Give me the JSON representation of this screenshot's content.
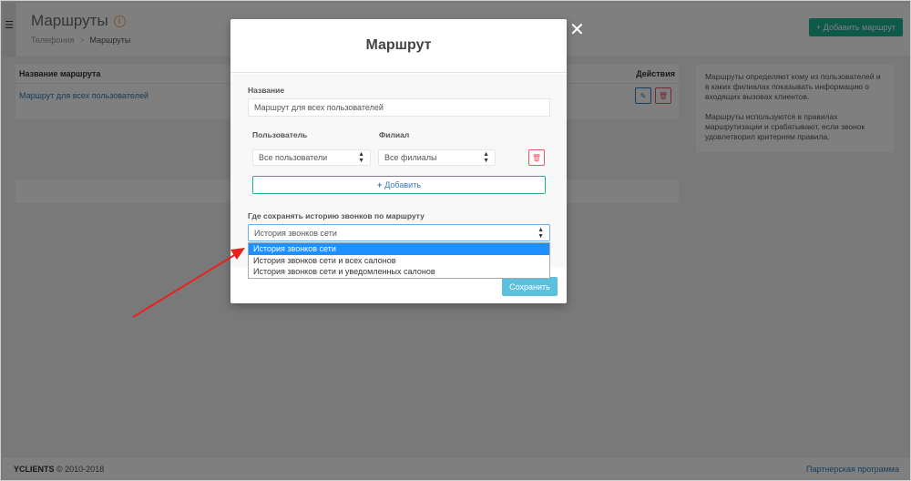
{
  "page": {
    "title": "Маршруты",
    "breadcrumb": [
      "Телефония",
      "Маршруты"
    ],
    "breadcrumb_sep": ">",
    "add_button": "Добавить маршрут"
  },
  "table": {
    "col_name": "Название маршрута",
    "col_actions": "Действия",
    "rows": [
      {
        "name": "Маршрут для всех пользователей"
      }
    ]
  },
  "info": {
    "p1": "Маршруты определяют кому из пользователей и в каких филиалах показывать информацию о входящих вызовах клиентов.",
    "p2": "Маршруты используются в правилах маршрутизации и срабатывают, если звонок удовлетворил критериям правила."
  },
  "footer": {
    "brand": "YCLIENTS",
    "copyright": "© 2010-2018",
    "partner": "Партнерская программа"
  },
  "modal": {
    "title": "Маршрут",
    "name_label": "Название",
    "name_value": "Маршрут для всех пользователей",
    "user_label": "Пользователь",
    "branch_label": "Филиал",
    "user_value": "Все пользователи",
    "branch_value": "Все филиалы",
    "add_label": "Добавить",
    "history_label": "Где сохранять историю звонков по маршруту",
    "history_value": "История звонков сети",
    "save_label": "Сохранить",
    "options": [
      "История звонков сети",
      "История звонков сети и всех салонов",
      "История звонков сети и уведомленных салонов"
    ],
    "selected_option": 0
  },
  "colors": {
    "primary": "#1ab394",
    "danger": "#ed5565",
    "info": "#5bc0de",
    "link": "#337ab7",
    "arrow": "#e8231f",
    "selected": "#1e90ff"
  }
}
